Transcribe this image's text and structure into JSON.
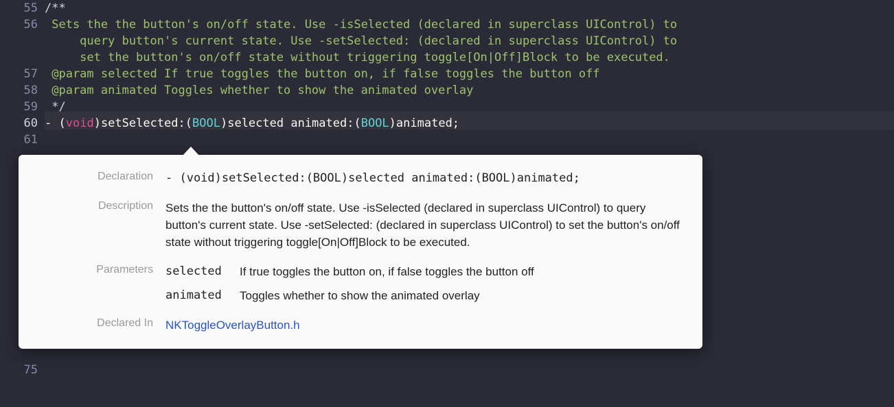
{
  "gutter": {
    "l55": "55",
    "l56": "56",
    "l57": "57",
    "l58": "58",
    "l59": "59",
    "l60": "60",
    "l61": "61",
    "l75": "75"
  },
  "code": {
    "line55": "/**",
    "line56a": " Sets the the button's on/off state. Use -isSelected (declared in superclass UIControl) to ",
    "line56b": "     query button's current state. Use -setSelected: (declared in superclass UIControl) to ",
    "line56c": "     set the button's on/off state without triggering toggle[On|Off]Block to be executed.",
    "line57": " @param selected If true toggles the button on, if false toggles the button off",
    "line58": " @param animated Toggles whether to show the animated overlay",
    "line59": " */",
    "line60_dash": "- ",
    "line60_po": "(",
    "line60_void": "void",
    "line60_pc": ")",
    "line60_m1": "setSelected:",
    "line60_po2": "(",
    "line60_bool1": "BOOL",
    "line60_pc2": ")",
    "line60_a1": "selected ",
    "line60_m2": "animated:",
    "line60_po3": "(",
    "line60_bool2": "BOOL",
    "line60_pc3": ")",
    "line60_a2": "animated;"
  },
  "popover": {
    "lblDecl": "Declaration",
    "decl": "- (void)setSelected:(BOOL)selected animated:(BOOL)animated;",
    "lblDesc": "Description",
    "desc": "Sets the the button's on/off state. Use -isSelected (declared in superclass UIControl) to query button's current state. Use -setSelected: (declared in superclass UIControl) to set the button's on/off state without triggering toggle[On|Off]Block to be executed.",
    "lblParams": "Parameters",
    "p1name": "selected",
    "p1desc": "If true toggles the button on, if false toggles the button off",
    "p2name": "animated",
    "p2desc": "Toggles whether to show the animated overlay",
    "lblDeclIn": "Declared In",
    "declIn": "NKToggleOverlayButton.h"
  }
}
